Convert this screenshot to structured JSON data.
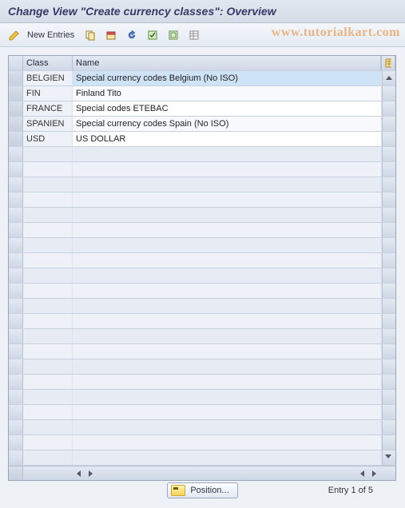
{
  "title": "Change View \"Create currency classes\": Overview",
  "toolbar": {
    "new_entries_label": "New Entries"
  },
  "watermark": "www.tutorialkart.com",
  "table": {
    "headers": {
      "class": "Class",
      "name": "Name"
    },
    "rows": [
      {
        "class": "BELGIEN",
        "name": "Special currency codes Belgium (No ISO)",
        "selected": true
      },
      {
        "class": "FIN",
        "name": "Finland Tito",
        "selected": false
      },
      {
        "class": "FRANCE",
        "name": "Special codes ETEBAC",
        "selected": false
      },
      {
        "class": "SPANIEN",
        "name": "Special currency codes Spain (No ISO)",
        "selected": false
      },
      {
        "class": "USD",
        "name": "US DOLLAR",
        "selected": false
      }
    ],
    "empty_rows": 21
  },
  "footer": {
    "position_label": "Position...",
    "entry_label": "Entry 1 of 5"
  }
}
